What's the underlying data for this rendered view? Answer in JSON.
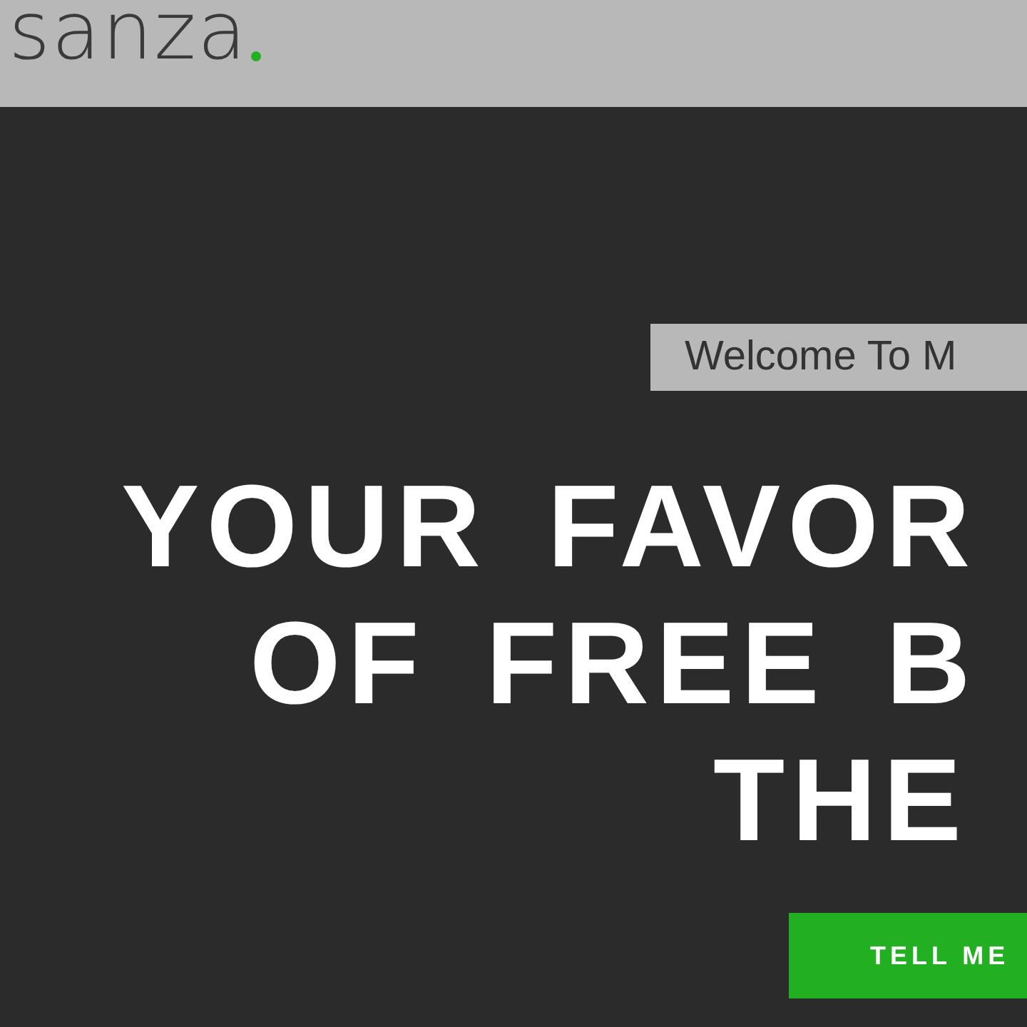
{
  "header": {
    "logo": "sanza"
  },
  "hero": {
    "welcome": "Welcome To M",
    "headline": [
      "YOUR FAVOR",
      "OF FREE B",
      "THE"
    ],
    "button": "TELL ME"
  }
}
